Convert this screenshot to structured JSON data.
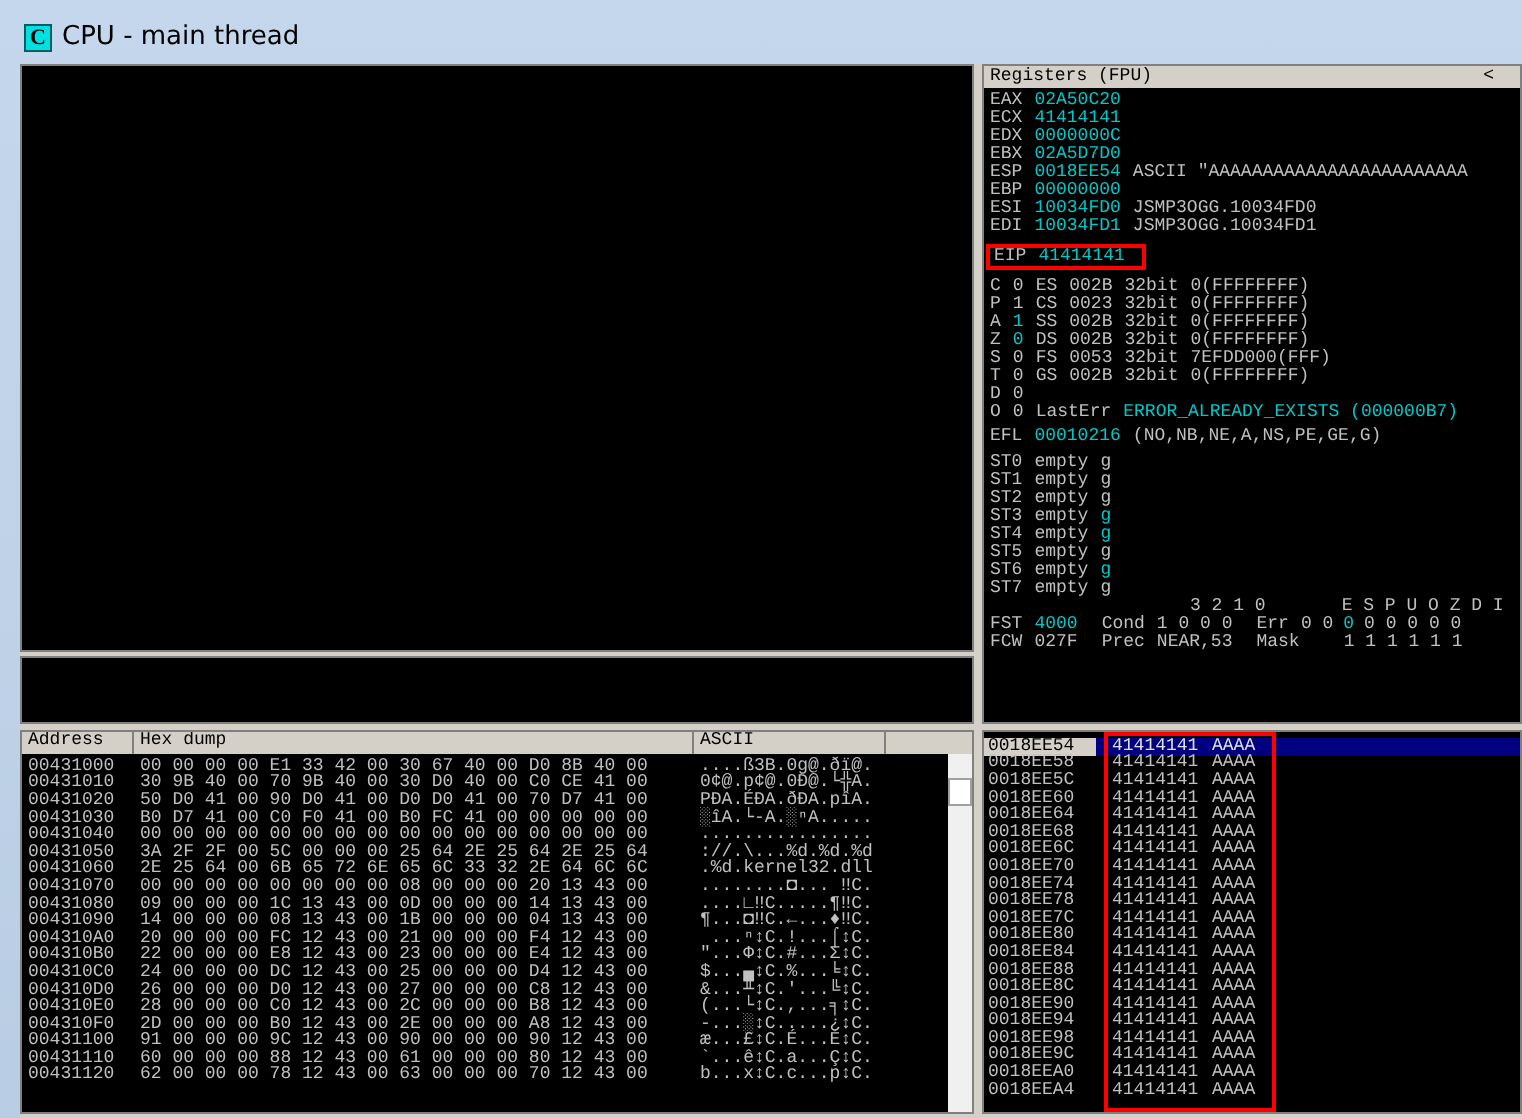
{
  "window": {
    "title": "CPU - main thread",
    "icon_letter": "C"
  },
  "registers": {
    "title": "Registers (FPU)",
    "collapse": "<",
    "general": [
      {
        "name": "EAX",
        "value": "02A50C20",
        "changed": true
      },
      {
        "name": "ECX",
        "value": "41414141",
        "changed": true
      },
      {
        "name": "EDX",
        "value": "0000000C",
        "changed": true
      },
      {
        "name": "EBX",
        "value": "02A5D7D0",
        "changed": true
      },
      {
        "name": "ESP",
        "value": "0018EE54",
        "comment": "ASCII \"AAAAAAAAAAAAAAAAAAAAAAAA",
        "changed": true
      },
      {
        "name": "EBP",
        "value": "00000000",
        "changed": true
      },
      {
        "name": "ESI",
        "value": "10034FD0",
        "comment": "JSMP3OGG.10034FD0",
        "changed": true
      },
      {
        "name": "EDI",
        "value": "10034FD1",
        "comment": "JSMP3OGG.10034FD1",
        "changed": true
      }
    ],
    "eip": {
      "name": "EIP",
      "value": "41414141",
      "changed": true,
      "highlighted": true
    },
    "flags": [
      {
        "flag": "C",
        "bit": "0",
        "changed": false,
        "seg": "ES",
        "sel": "002B",
        "bits": "32bit",
        "base": "0(FFFFFFFF)"
      },
      {
        "flag": "P",
        "bit": "1",
        "changed": false,
        "seg": "CS",
        "sel": "0023",
        "bits": "32bit",
        "base": "0(FFFFFFFF)"
      },
      {
        "flag": "A",
        "bit": "1",
        "changed": true,
        "seg": "SS",
        "sel": "002B",
        "bits": "32bit",
        "base": "0(FFFFFFFF)"
      },
      {
        "flag": "Z",
        "bit": "0",
        "changed": true,
        "seg": "DS",
        "sel": "002B",
        "bits": "32bit",
        "base": "0(FFFFFFFF)"
      },
      {
        "flag": "S",
        "bit": "0",
        "changed": false,
        "seg": "FS",
        "sel": "0053",
        "bits": "32bit",
        "base": "7EFDD000(FFF)"
      },
      {
        "flag": "T",
        "bit": "0",
        "changed": false,
        "seg": "GS",
        "sel": "002B",
        "bits": "32bit",
        "base": "0(FFFFFFFF)"
      },
      {
        "flag": "D",
        "bit": "0",
        "changed": false
      },
      {
        "flag": "O",
        "bit": "0",
        "changed": false,
        "label": "LastErr",
        "error": "ERROR_ALREADY_EXISTS (000000B7)"
      }
    ],
    "efl": {
      "name": "EFL",
      "value": "00010216",
      "decoded": "(NO,NB,NE,A,NS,PE,GE,G)"
    },
    "fpu": [
      {
        "name": "ST0",
        "value": "empty",
        "tag": "g",
        "changed": false
      },
      {
        "name": "ST1",
        "value": "empty",
        "tag": "g",
        "changed": false
      },
      {
        "name": "ST2",
        "value": "empty",
        "tag": "g",
        "changed": false
      },
      {
        "name": "ST3",
        "value": "empty",
        "tag": "g",
        "changed": true
      },
      {
        "name": "ST4",
        "value": "empty",
        "tag": "g",
        "changed": true
      },
      {
        "name": "ST5",
        "value": "empty",
        "tag": "g",
        "changed": false
      },
      {
        "name": "ST6",
        "value": "empty",
        "tag": "g",
        "changed": true
      },
      {
        "name": "ST7",
        "value": "empty",
        "tag": "g",
        "changed": false
      }
    ],
    "fpu_header": {
      "cond_bits": "3 2 1 0",
      "err_bits": "E S P U O Z D I"
    },
    "fst": {
      "name": "FST",
      "value": "4000",
      "cond_label": "Cond",
      "cond": "1 0 0 0",
      "err_label": "Err",
      "err_before": "0 0",
      "err_changed": "0",
      "err_after": "0 0 0 0 0"
    },
    "fcw": {
      "name": "FCW",
      "value": "027F",
      "prec_label": "Prec",
      "prec": "NEAR,53",
      "mask_label": "Mask",
      "mask": "1 1 1 1 1 1"
    }
  },
  "dump": {
    "columns": [
      "Address",
      "Hex dump",
      "ASCII"
    ],
    "rows": [
      {
        "address": "00431000",
        "hex": "00 00 00 00 E1 33 42 00 30 67 40 00 D0 8B 40 00",
        "ascii": "....ß3B.0g@.ðï@."
      },
      {
        "address": "00431010",
        "hex": "30 9B 40 00 70 9B 40 00 30 D0 40 00 C0 CE 41 00",
        "ascii": "0¢@.p¢@.0Ð@.└╬A."
      },
      {
        "address": "00431020",
        "hex": "50 D0 41 00 90 D0 41 00 D0 D0 41 00 70 D7 41 00",
        "ascii": "PÐA.ÉÐA.ðÐA.pîA."
      },
      {
        "address": "00431030",
        "hex": "B0 D7 41 00 C0 F0 41 00 B0 FC 41 00 00 00 00 00",
        "ascii": "░îA.└-A.░ⁿA....."
      },
      {
        "address": "00431040",
        "hex": "00 00 00 00 00 00 00 00 00 00 00 00 00 00 00 00",
        "ascii": "................"
      },
      {
        "address": "00431050",
        "hex": "3A 2F 2F 00 5C 00 00 00 25 64 2E 25 64 2E 25 64",
        "ascii": "://.\\...%d.%d.%d"
      },
      {
        "address": "00431060",
        "hex": "2E 25 64 00 6B 65 72 6E 65 6C 33 32 2E 64 6C 6C",
        "ascii": ".%d.kernel32.dll"
      },
      {
        "address": "00431070",
        "hex": "00 00 00 00 00 00 00 00 08 00 00 00 20 13 43 00",
        "ascii": "........◘... ‼C."
      },
      {
        "address": "00431080",
        "hex": "09 00 00 00 1C 13 43 00 0D 00 00 00 14 13 43 00",
        "ascii": "....∟‼C.....¶‼C."
      },
      {
        "address": "00431090",
        "hex": "14 00 00 00 08 13 43 00 1B 00 00 00 04 13 43 00",
        "ascii": "¶...◘‼C.←...♦‼C."
      },
      {
        "address": "004310A0",
        "hex": "20 00 00 00 FC 12 43 00 21 00 00 00 F4 12 43 00",
        "ascii": " ...ⁿ↕C.!...⌠↕C."
      },
      {
        "address": "004310B0",
        "hex": "22 00 00 00 E8 12 43 00 23 00 00 00 E4 12 43 00",
        "ascii": "\"...Φ↕C.#...Σ↕C."
      },
      {
        "address": "004310C0",
        "hex": "24 00 00 00 DC 12 43 00 25 00 00 00 D4 12 43 00",
        "ascii": "$...▄↕C.%...╘↕C."
      },
      {
        "address": "004310D0",
        "hex": "26 00 00 00 D0 12 43 00 27 00 00 00 C8 12 43 00",
        "ascii": "&...╨↕C.'...╚↕C."
      },
      {
        "address": "004310E0",
        "hex": "28 00 00 00 C0 12 43 00 2C 00 00 00 B8 12 43 00",
        "ascii": "(...└↕C.,...╕↕C."
      },
      {
        "address": "004310F0",
        "hex": "2D 00 00 00 B0 12 43 00 2E 00 00 00 A8 12 43 00",
        "ascii": "-...░↕C.....¿↕C."
      },
      {
        "address": "00431100",
        "hex": "91 00 00 00 9C 12 43 00 90 00 00 00 90 12 43 00",
        "ascii": "æ...£↕C.É...É↕C."
      },
      {
        "address": "00431110",
        "hex": "60 00 00 00 88 12 43 00 61 00 00 00 80 12 43 00",
        "ascii": "`...ê↕C.a...Ç↕C."
      },
      {
        "address": "00431120",
        "hex": "62 00 00 00 78 12 43 00 63 00 00 00 70 12 43 00",
        "ascii": "b...x↕C.c...p↕C."
      }
    ]
  },
  "stack": {
    "highlighted": true,
    "rows": [
      {
        "address": "0018EE54",
        "value": "41414141",
        "ascii": "AAAA",
        "selected": true
      },
      {
        "address": "0018EE58",
        "value": "41414141",
        "ascii": "AAAA",
        "selected": false
      },
      {
        "address": "0018EE5C",
        "value": "41414141",
        "ascii": "AAAA",
        "selected": false
      },
      {
        "address": "0018EE60",
        "value": "41414141",
        "ascii": "AAAA",
        "selected": false
      },
      {
        "address": "0018EE64",
        "value": "41414141",
        "ascii": "AAAA",
        "selected": false
      },
      {
        "address": "0018EE68",
        "value": "41414141",
        "ascii": "AAAA",
        "selected": false
      },
      {
        "address": "0018EE6C",
        "value": "41414141",
        "ascii": "AAAA",
        "selected": false
      },
      {
        "address": "0018EE70",
        "value": "41414141",
        "ascii": "AAAA",
        "selected": false
      },
      {
        "address": "0018EE74",
        "value": "41414141",
        "ascii": "AAAA",
        "selected": false
      },
      {
        "address": "0018EE78",
        "value": "41414141",
        "ascii": "AAAA",
        "selected": false
      },
      {
        "address": "0018EE7C",
        "value": "41414141",
        "ascii": "AAAA",
        "selected": false
      },
      {
        "address": "0018EE80",
        "value": "41414141",
        "ascii": "AAAA",
        "selected": false
      },
      {
        "address": "0018EE84",
        "value": "41414141",
        "ascii": "AAAA",
        "selected": false
      },
      {
        "address": "0018EE88",
        "value": "41414141",
        "ascii": "AAAA",
        "selected": false
      },
      {
        "address": "0018EE8C",
        "value": "41414141",
        "ascii": "AAAA",
        "selected": false
      },
      {
        "address": "0018EE90",
        "value": "41414141",
        "ascii": "AAAA",
        "selected": false
      },
      {
        "address": "0018EE94",
        "value": "41414141",
        "ascii": "AAAA",
        "selected": false
      },
      {
        "address": "0018EE98",
        "value": "41414141",
        "ascii": "AAAA",
        "selected": false
      },
      {
        "address": "0018EE9C",
        "value": "41414141",
        "ascii": "AAAA",
        "selected": false
      },
      {
        "address": "0018EEA0",
        "value": "41414141",
        "ascii": "AAAA",
        "selected": false
      },
      {
        "address": "0018EEA4",
        "value": "41414141",
        "ascii": "AAAA",
        "selected": false
      }
    ]
  }
}
